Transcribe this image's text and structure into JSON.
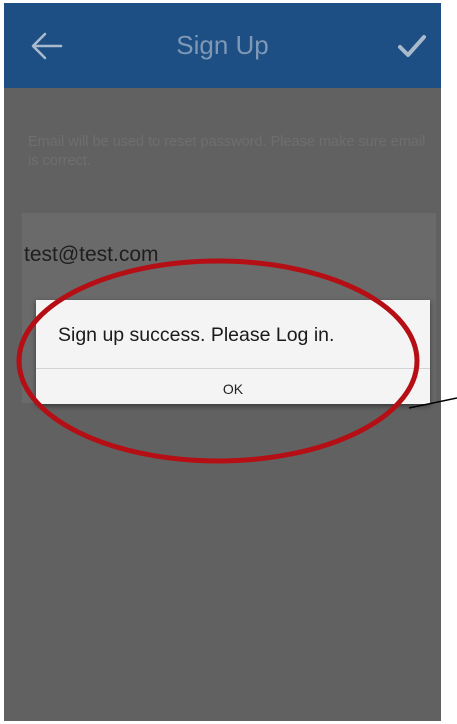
{
  "app_bar": {
    "title": "Sign Up",
    "color": "#1d4f84",
    "back_icon": "arrow-left-icon",
    "confirm_icon": "checkmark-icon"
  },
  "form": {
    "hint": "Email will be used to reset password. Please make sure email is correct.",
    "email_value": "test@test.com"
  },
  "dialog": {
    "message": "Sign up success. Please Log in.",
    "ok_label": "OK"
  },
  "annotation": {
    "highlight_color": "#b50e14"
  }
}
